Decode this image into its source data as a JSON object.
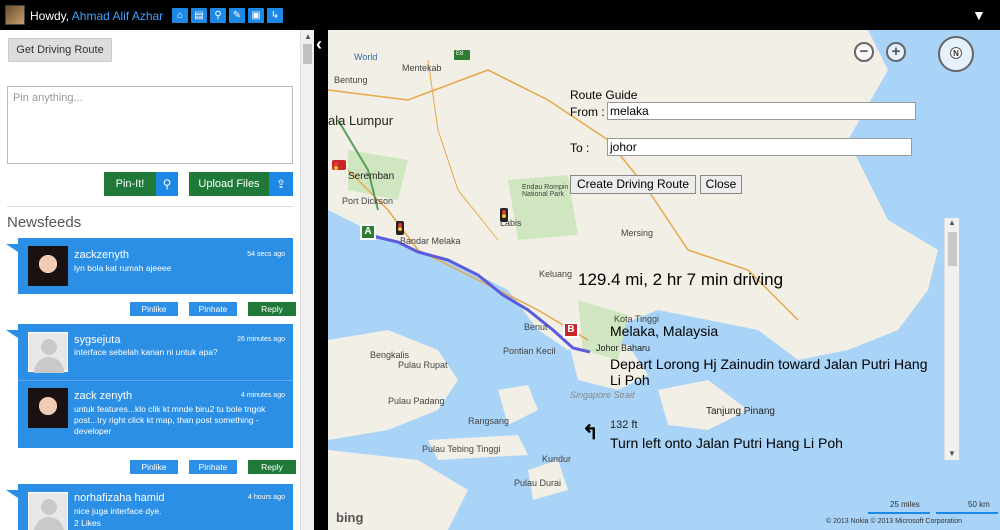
{
  "topbar": {
    "greeting": "Howdy, ",
    "username": "Ahmad Alif Azhar",
    "icons": [
      "home-icon",
      "newspaper-icon",
      "search-icon",
      "wrench-icon",
      "inbox-icon",
      "logout-icon"
    ]
  },
  "sidebar": {
    "get_route_label": "Get Driving Route",
    "pin_placeholder": "Pin anything...",
    "pin_label": "Pin-It!",
    "upload_label": "Upload Files",
    "newsfeeds_title": "Newsfeeds",
    "feeds": [
      {
        "name": "zackzenyth",
        "time": "54 secs ago",
        "text": "lyn bola kat rumah ajeeee",
        "pinlike": "Pinlike",
        "pinhate": "Pinhate",
        "reply": "Reply"
      },
      {
        "name": "sygsejuta",
        "time": "26 minutes ago",
        "text": "interface sebelah kanan ni untuk apa?",
        "sub_name": "zack zenyth",
        "sub_time": "4 minutes ago",
        "sub_text": "untuk features...klo clik kt mnde biru2 tu bole tngok post...try right click kt map, than post something - developer",
        "pinlike": "Pinlike",
        "pinhate": "Pinhate",
        "reply": "Reply"
      },
      {
        "name": "norhafizaha hamid",
        "time": "4 hours ago",
        "text": "nice juga interface dye.",
        "likes": "2 Likes"
      }
    ]
  },
  "map": {
    "labels": {
      "world": "World",
      "bentung": "Bentung",
      "mentekab": "Mentekab",
      "e8": "E8",
      "kuala_lumpur": "ala Lumpur",
      "seremban": "Seremban",
      "port_dickson": "Port Dickson",
      "bandar_melaka": "Bandar Melaka",
      "endau": "Endau Rompin National Park",
      "labis": "Labis",
      "mersing": "Mersing",
      "keluang": "Keluang",
      "benut": "Benut",
      "kota_tinggi": "Kota Tinggi",
      "pontian": "Pontian Kecil",
      "johor_bahru": "Johor Baharu",
      "singapore": "Singapore",
      "singapore_strait": "Singapore Strait",
      "bengkalis": "Bengkalis",
      "pulau_rupat": "Pulau Rupat",
      "pulau_padang": "Pulau Padang",
      "pulau_rangsang": "Rangsang",
      "tebing": "Pulau Tebing Tinggi",
      "kundur": "Kundur",
      "tanjung_pinang": "Tanjung Pinang",
      "pulau_durai": "Pulau Durai"
    },
    "route_panel": {
      "title": "Route Guide",
      "from_label": "From :",
      "from_value": "melaka",
      "to_label": "To    :",
      "to_value": "johor",
      "create_label": "Create Driving Route",
      "close_label": "Close"
    },
    "directions": {
      "summary": "129.4 mi, 2 hr 7 min driving",
      "destination": "Melaka, Malaysia",
      "step1": "Depart Lorong Hj Zainudin toward Jalan Putri Hang Li Poh",
      "distance": "132 ft",
      "step2": "Turn left onto Jalan Putri Hang Li Poh"
    },
    "scale_miles": "25 miles",
    "scale_km": "50 km",
    "copyright": "© 2013 Nokia   © 2013 Microsoft Corporation",
    "brand": "bing"
  }
}
